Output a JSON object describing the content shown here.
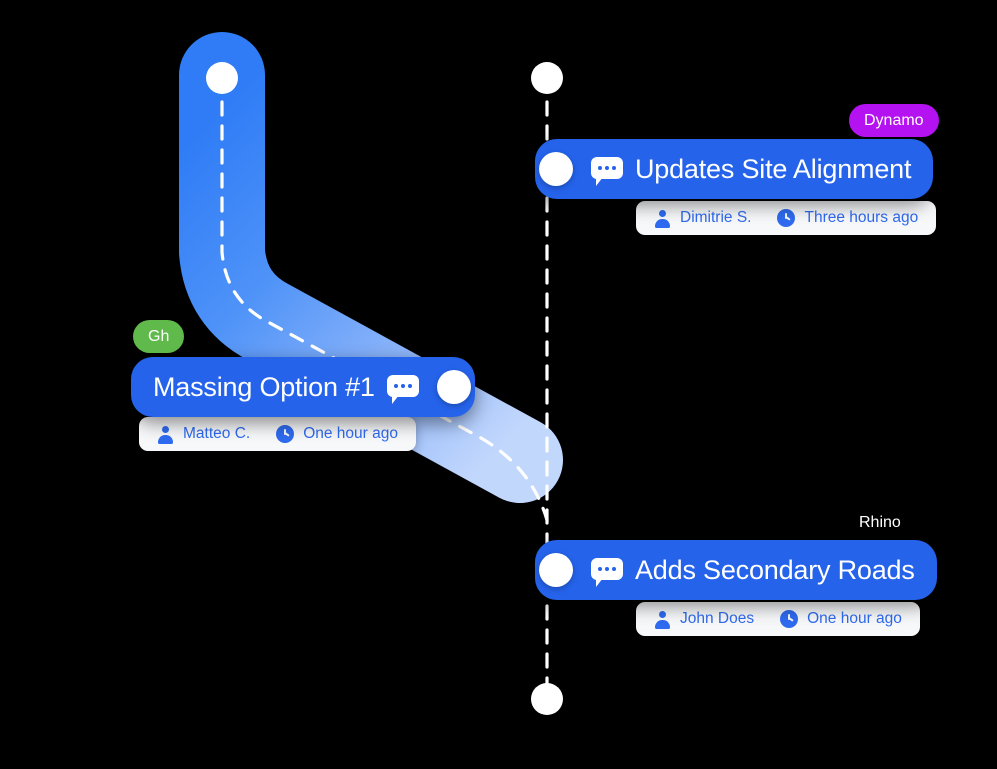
{
  "graph": {
    "title": "activity-branch-timeline",
    "colors": {
      "background": "#000000",
      "branch_top": "#3b82f6",
      "branch_bottom": "#cfddfb",
      "card": "#2563eb",
      "meta_text": "#2f6bf0",
      "meta_bg": "#f7f8fa",
      "node": "#ffffff",
      "badge_dynamo": "#b412f0",
      "badge_gh": "#5fb94b"
    },
    "branches": [
      {
        "name": "left-feature-branch",
        "label": "Gh",
        "merges_into": "main"
      },
      {
        "name": "main-trunk",
        "label": "Rhino"
      }
    ]
  },
  "badges": [
    {
      "id": "dynamo",
      "label": "Dynamo",
      "style": "filled",
      "color": "#b412f0"
    },
    {
      "id": "gh",
      "label": "Gh",
      "style": "filled",
      "color": "#5fb94b"
    },
    {
      "id": "rhino",
      "label": "Rhino",
      "style": "plain",
      "color": "#ffffff"
    }
  ],
  "commits": [
    {
      "id": "updates-site-alignment",
      "title": "Updates Site Alignment",
      "icon": "chat-icon",
      "dot_side": "left",
      "badge": "Dynamo",
      "author": "Dimitrie S.",
      "time": "Three hours ago",
      "branch": "main-trunk"
    },
    {
      "id": "massing-option-1",
      "title": "Massing Option #1",
      "icon": "chat-icon",
      "dot_side": "right",
      "badge": "Gh",
      "author": "Matteo C.",
      "time": "One hour ago",
      "branch": "left-feature-branch"
    },
    {
      "id": "adds-secondary-roads",
      "title": "Adds Secondary Roads",
      "icon": "chat-icon",
      "dot_side": "left",
      "badge": "Rhino",
      "author": "John Does",
      "time": "One hour ago",
      "branch": "main-trunk"
    }
  ],
  "nodes": [
    {
      "id": "left-branch-head",
      "branch": "left-feature-branch"
    },
    {
      "id": "main-branch-head",
      "branch": "main-trunk"
    },
    {
      "id": "main-branch-tail",
      "branch": "main-trunk"
    }
  ]
}
